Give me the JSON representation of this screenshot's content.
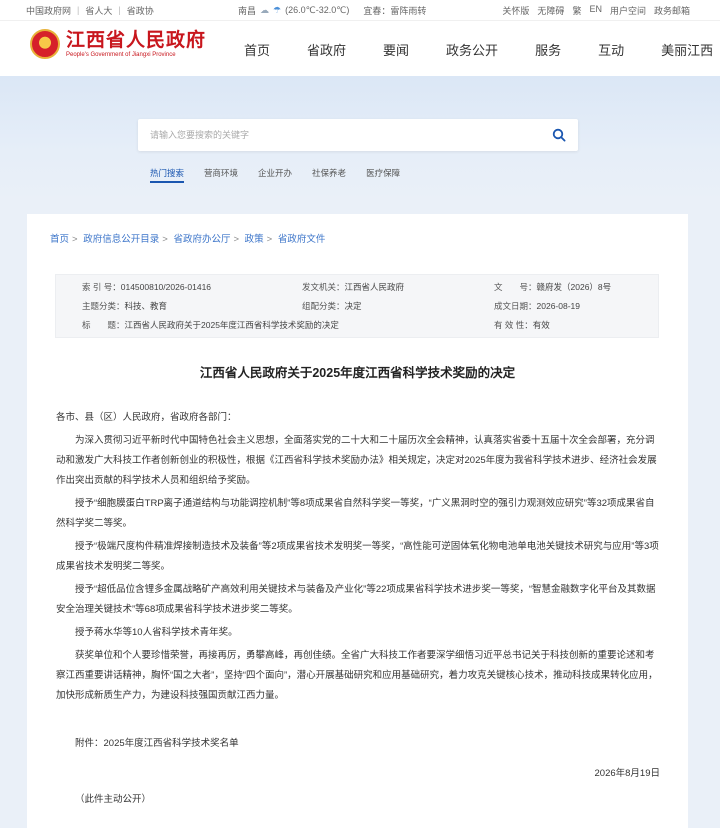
{
  "topbar": {
    "links": [
      "中国政府网",
      "省人大",
      "省政协"
    ],
    "weather": {
      "city": "南昌",
      "temp": "(26.0℃-32.0℃)",
      "warn": "宜春：雷阵雨转"
    },
    "tools": [
      "关怀版",
      "无障碍",
      "繁",
      "EN",
      "用户空间",
      "政务邮箱"
    ]
  },
  "header": {
    "logo_cn": "江西省人民政府",
    "logo_en": "People's Government of Jiangxi Province",
    "nav": [
      "首页",
      "省政府",
      "要闻",
      "政务公开",
      "服务",
      "互动",
      "美丽江西"
    ]
  },
  "search": {
    "placeholder": "请输入您要搜索的关键字",
    "hot": [
      "热门搜索",
      "营商环境",
      "企业开办",
      "社保养老",
      "医疗保障"
    ]
  },
  "breadcrumb": [
    "首页",
    "政府信息公开目录",
    "省政府办公厅",
    "政策",
    "省政府文件"
  ],
  "meta": {
    "index_k": "索 引 号：",
    "index_v": "014500810/2026-01416",
    "org_k": "发文机关：",
    "org_v": "江西省人民政府",
    "num_k": "文　　号：",
    "num_v": "赣府发（2026）8号",
    "topic_k": "主题分类：",
    "topic_v": "科技、教育",
    "form_k": "组配分类：",
    "form_v": "决定",
    "date_k": "成文日期：",
    "date_v": "2026-08-19",
    "title_k": "标　　题：",
    "title_v": "江西省人民政府关于2025年度江西省科学技术奖励的决定",
    "valid_k": "有 效 性：",
    "valid_v": "有效"
  },
  "doc": {
    "title": "江西省人民政府关于2025年度江西省科学技术奖励的决定",
    "salutation": "各市、县（区）人民政府，省政府各部门：",
    "paragraphs": [
      "为深入贯彻习近平新时代中国特色社会主义思想，全面落实党的二十大和二十届历次全会精神，认真落实省委十五届十次全会部署，充分调动和激发广大科技工作者创新创业的积极性，根据《江西省科学技术奖励办法》相关规定，决定对2025年度为我省科学技术进步、经济社会发展作出突出贡献的科学技术人员和组织给予奖励。",
      "授予“细胞膜蛋白TRP离子通道结构与功能调控机制”等8项成果省自然科学奖一等奖，“广义黑洞时空的强引力观测效应研究”等32项成果省自然科学奖二等奖。",
      "授予“极端尺度构件精准焊接制造技术及装备”等2项成果省技术发明奖一等奖，“高性能可逆固体氧化物电池单电池关键技术研究与应用”等3项成果省技术发明奖二等奖。",
      "授予“超低品位含锂多金属战略矿产高效利用关键技术与装备及产业化”等22项成果省科学技术进步奖一等奖，“智慧金融数字化平台及其数据安全治理关键技术”等68项成果省科学技术进步奖二等奖。",
      "授予蒋水华等10人省科学技术青年奖。",
      "获奖单位和个人要珍惜荣誉，再接再厉，勇攀高峰，再创佳绩。全省广大科技工作者要深学细悟习近平总书记关于科技创新的重要论述和考察江西重要讲话精神，胸怀“国之大者”，坚持“四个面向”，潜心开展基础研究和应用基础研究，着力攻克关键核心技术，推动科技成果转化应用，加快形成新质生产力，为建设科技强国贡献江西力量。"
    ],
    "attachment": "附件：2025年度江西省科学技术奖名单",
    "date": "2026年8月19日",
    "public": "（此件主动公开）"
  }
}
